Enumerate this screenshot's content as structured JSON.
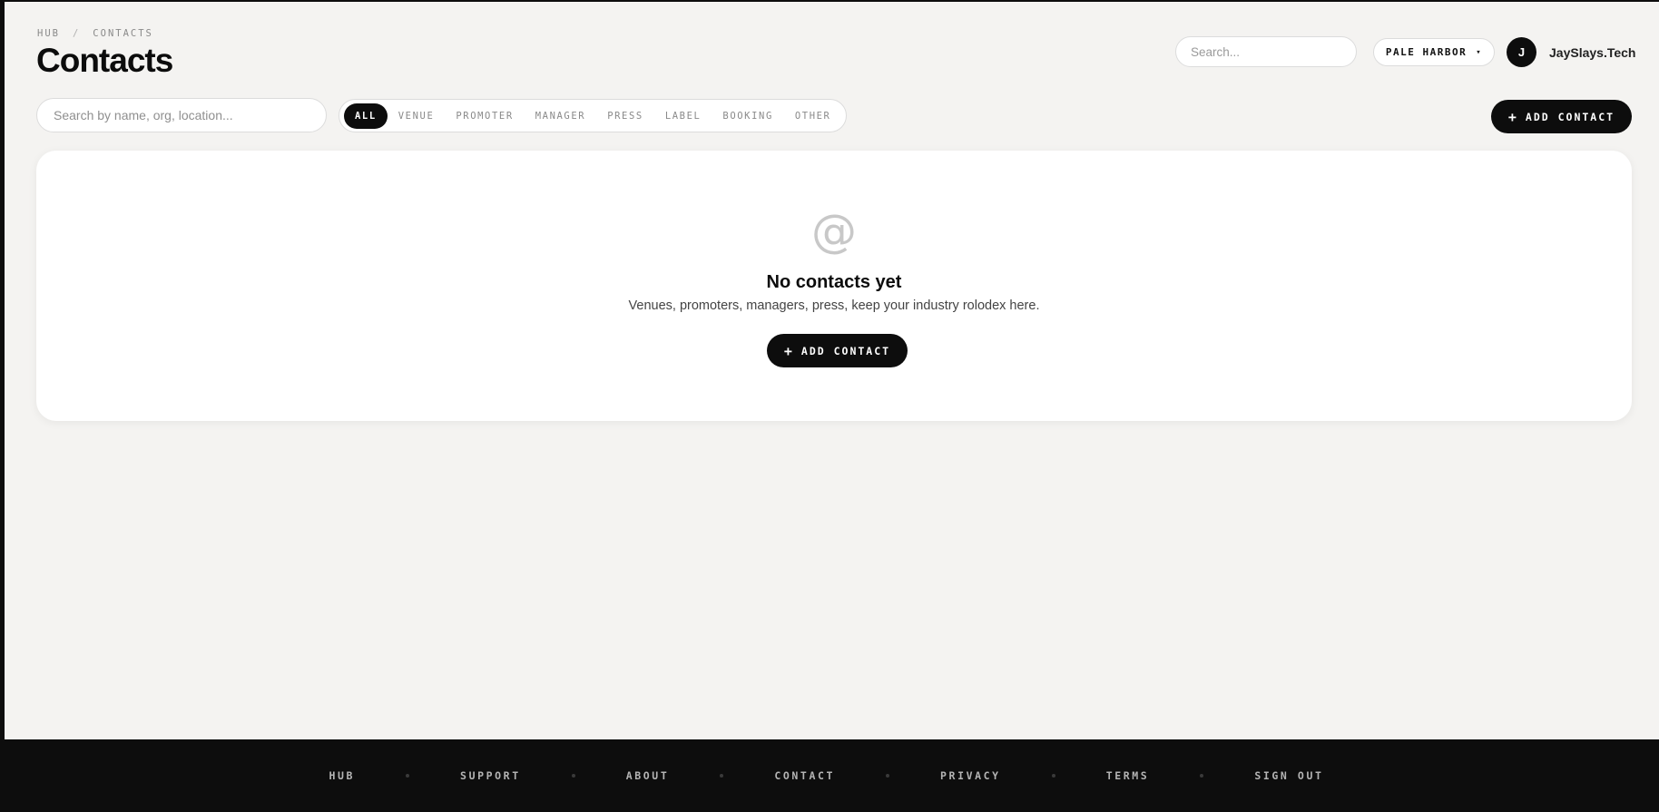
{
  "breadcrumb": {
    "items": [
      "HUB",
      "CONTACTS"
    ],
    "separator": "/"
  },
  "page_title": "Contacts",
  "header": {
    "search_placeholder": "Search...",
    "workspace": "PALE HARBOR",
    "workspace_caret": "▾",
    "avatar_initial": "J",
    "user_name": "JaySlays.Tech"
  },
  "toolbar": {
    "search_placeholder": "Search by name, org, location...",
    "filters": [
      "ALL",
      "VENUE",
      "PROMOTER",
      "MANAGER",
      "PRESS",
      "LABEL",
      "BOOKING",
      "OTHER"
    ],
    "active_filter": "ALL",
    "add_button_plus": "+",
    "add_button_label": "ADD CONTACT"
  },
  "empty_state": {
    "icon": "at-icon",
    "icon_glyph": "@",
    "title": "No contacts yet",
    "description": "Venues, promoters, managers, press, keep your industry rolodex here.",
    "button_plus": "+",
    "button_label": "ADD CONTACT"
  },
  "footer": {
    "links": [
      "HUB",
      "SUPPORT",
      "ABOUT",
      "CONTACT",
      "PRIVACY",
      "TERMS",
      "SIGN OUT"
    ]
  },
  "colors": {
    "background": "#f4f3f1",
    "dark": "#0d0d0d",
    "card": "#ffffff",
    "muted_text": "#8a8a8a"
  }
}
